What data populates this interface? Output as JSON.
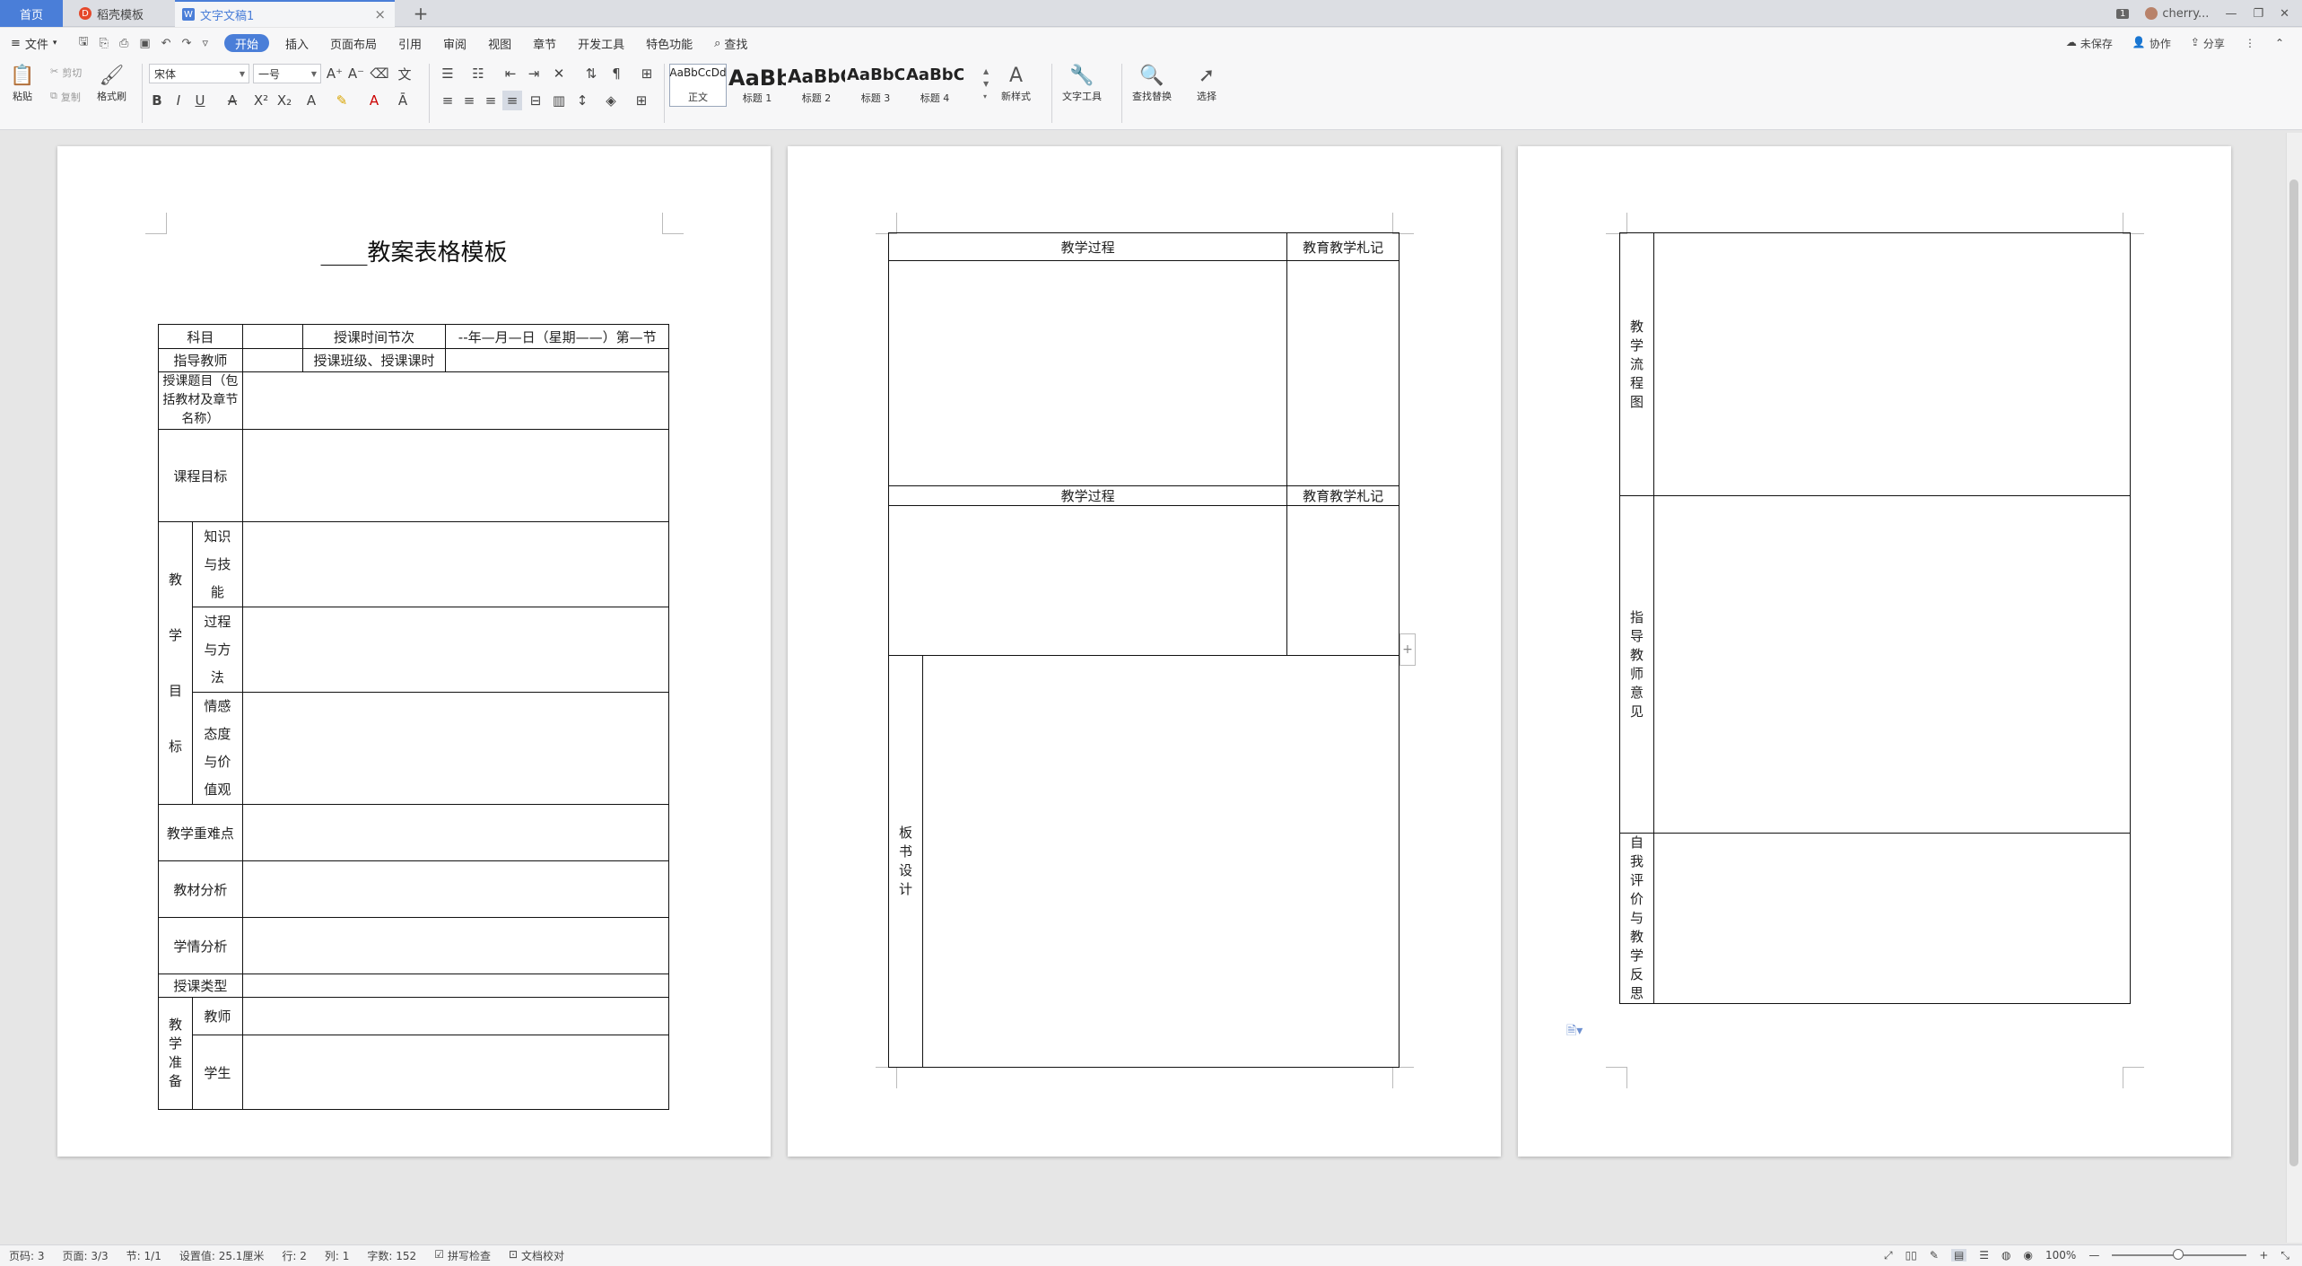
{
  "tabs": {
    "home": "首页",
    "daoke": "稻壳模板",
    "doc": "文字文稿1",
    "close": "×",
    "add": "+"
  },
  "window": {
    "badge": "1",
    "user": "cherry..."
  },
  "menu": {
    "file": "文件",
    "items": [
      "开始",
      "插入",
      "页面布局",
      "引用",
      "审阅",
      "视图",
      "章节",
      "开发工具",
      "特色功能"
    ],
    "search": "查找",
    "unsaved": "未保存",
    "collab": "协作",
    "share": "分享"
  },
  "ribbon": {
    "paste": "粘贴",
    "cut": "剪切",
    "copy": "复制",
    "format_painter": "格式刷",
    "font_name": "宋体",
    "font_size": "一号",
    "styles": [
      {
        "preview": "AaBbCcDd",
        "label": "正文"
      },
      {
        "preview": "AaBb",
        "label": "标题 1"
      },
      {
        "preview": "AaBbC",
        "label": "标题 2"
      },
      {
        "preview": "AaBbC",
        "label": "标题 3"
      },
      {
        "preview": "AaBbC",
        "label": "标题 4"
      }
    ],
    "new_style": "新样式",
    "text_tools": "文字工具",
    "find_replace": "查找替换",
    "select": "选择"
  },
  "page1": {
    "title": "____教案表格模板",
    "rows": {
      "subject": "科目",
      "time_label": "授课时间节次",
      "time_value": "--年—月—日（星期——）第—节",
      "teacher": "指导教师",
      "class_label": "授课班级、授课课时",
      "topic": "授课题目（包括教材及章节名称）",
      "goal": "课程目标",
      "teach_goal_chars": [
        "教",
        "学",
        "目",
        "标"
      ],
      "knowledge": [
        "知识",
        "与技",
        "能"
      ],
      "process": [
        "过程",
        "与方",
        "法"
      ],
      "emotion": [
        "情感",
        "态度",
        "与价",
        "值观"
      ],
      "key_points": "教学重难点",
      "material": "教材分析",
      "learner": "学情分析",
      "lesson_type": "授课类型",
      "prep_chars": [
        "教",
        "学",
        "准",
        "备"
      ],
      "teacher_prep": "教师",
      "student_prep": "学生"
    }
  },
  "page2": {
    "process": "教学过程",
    "notes": "教育教学札记",
    "board": [
      "板",
      "书",
      "设",
      "计"
    ]
  },
  "page3": {
    "flow": [
      "教",
      "学",
      "流",
      "程",
      "图"
    ],
    "opinion": [
      "指",
      "导",
      "教",
      "师",
      "意",
      "见"
    ],
    "reflection": [
      "自",
      "我",
      "评",
      "价",
      "与",
      "教",
      "学",
      "反",
      "思"
    ]
  },
  "status": {
    "page_num": "页码: 3",
    "pages": "页面: 3/3",
    "section": "节: 1/1",
    "setting": "设置值: 25.1厘米",
    "row": "行: 2",
    "col": "列: 1",
    "words": "字数: 152",
    "spell": "拼写检查",
    "proof": "文档校对",
    "zoom": "100%"
  }
}
